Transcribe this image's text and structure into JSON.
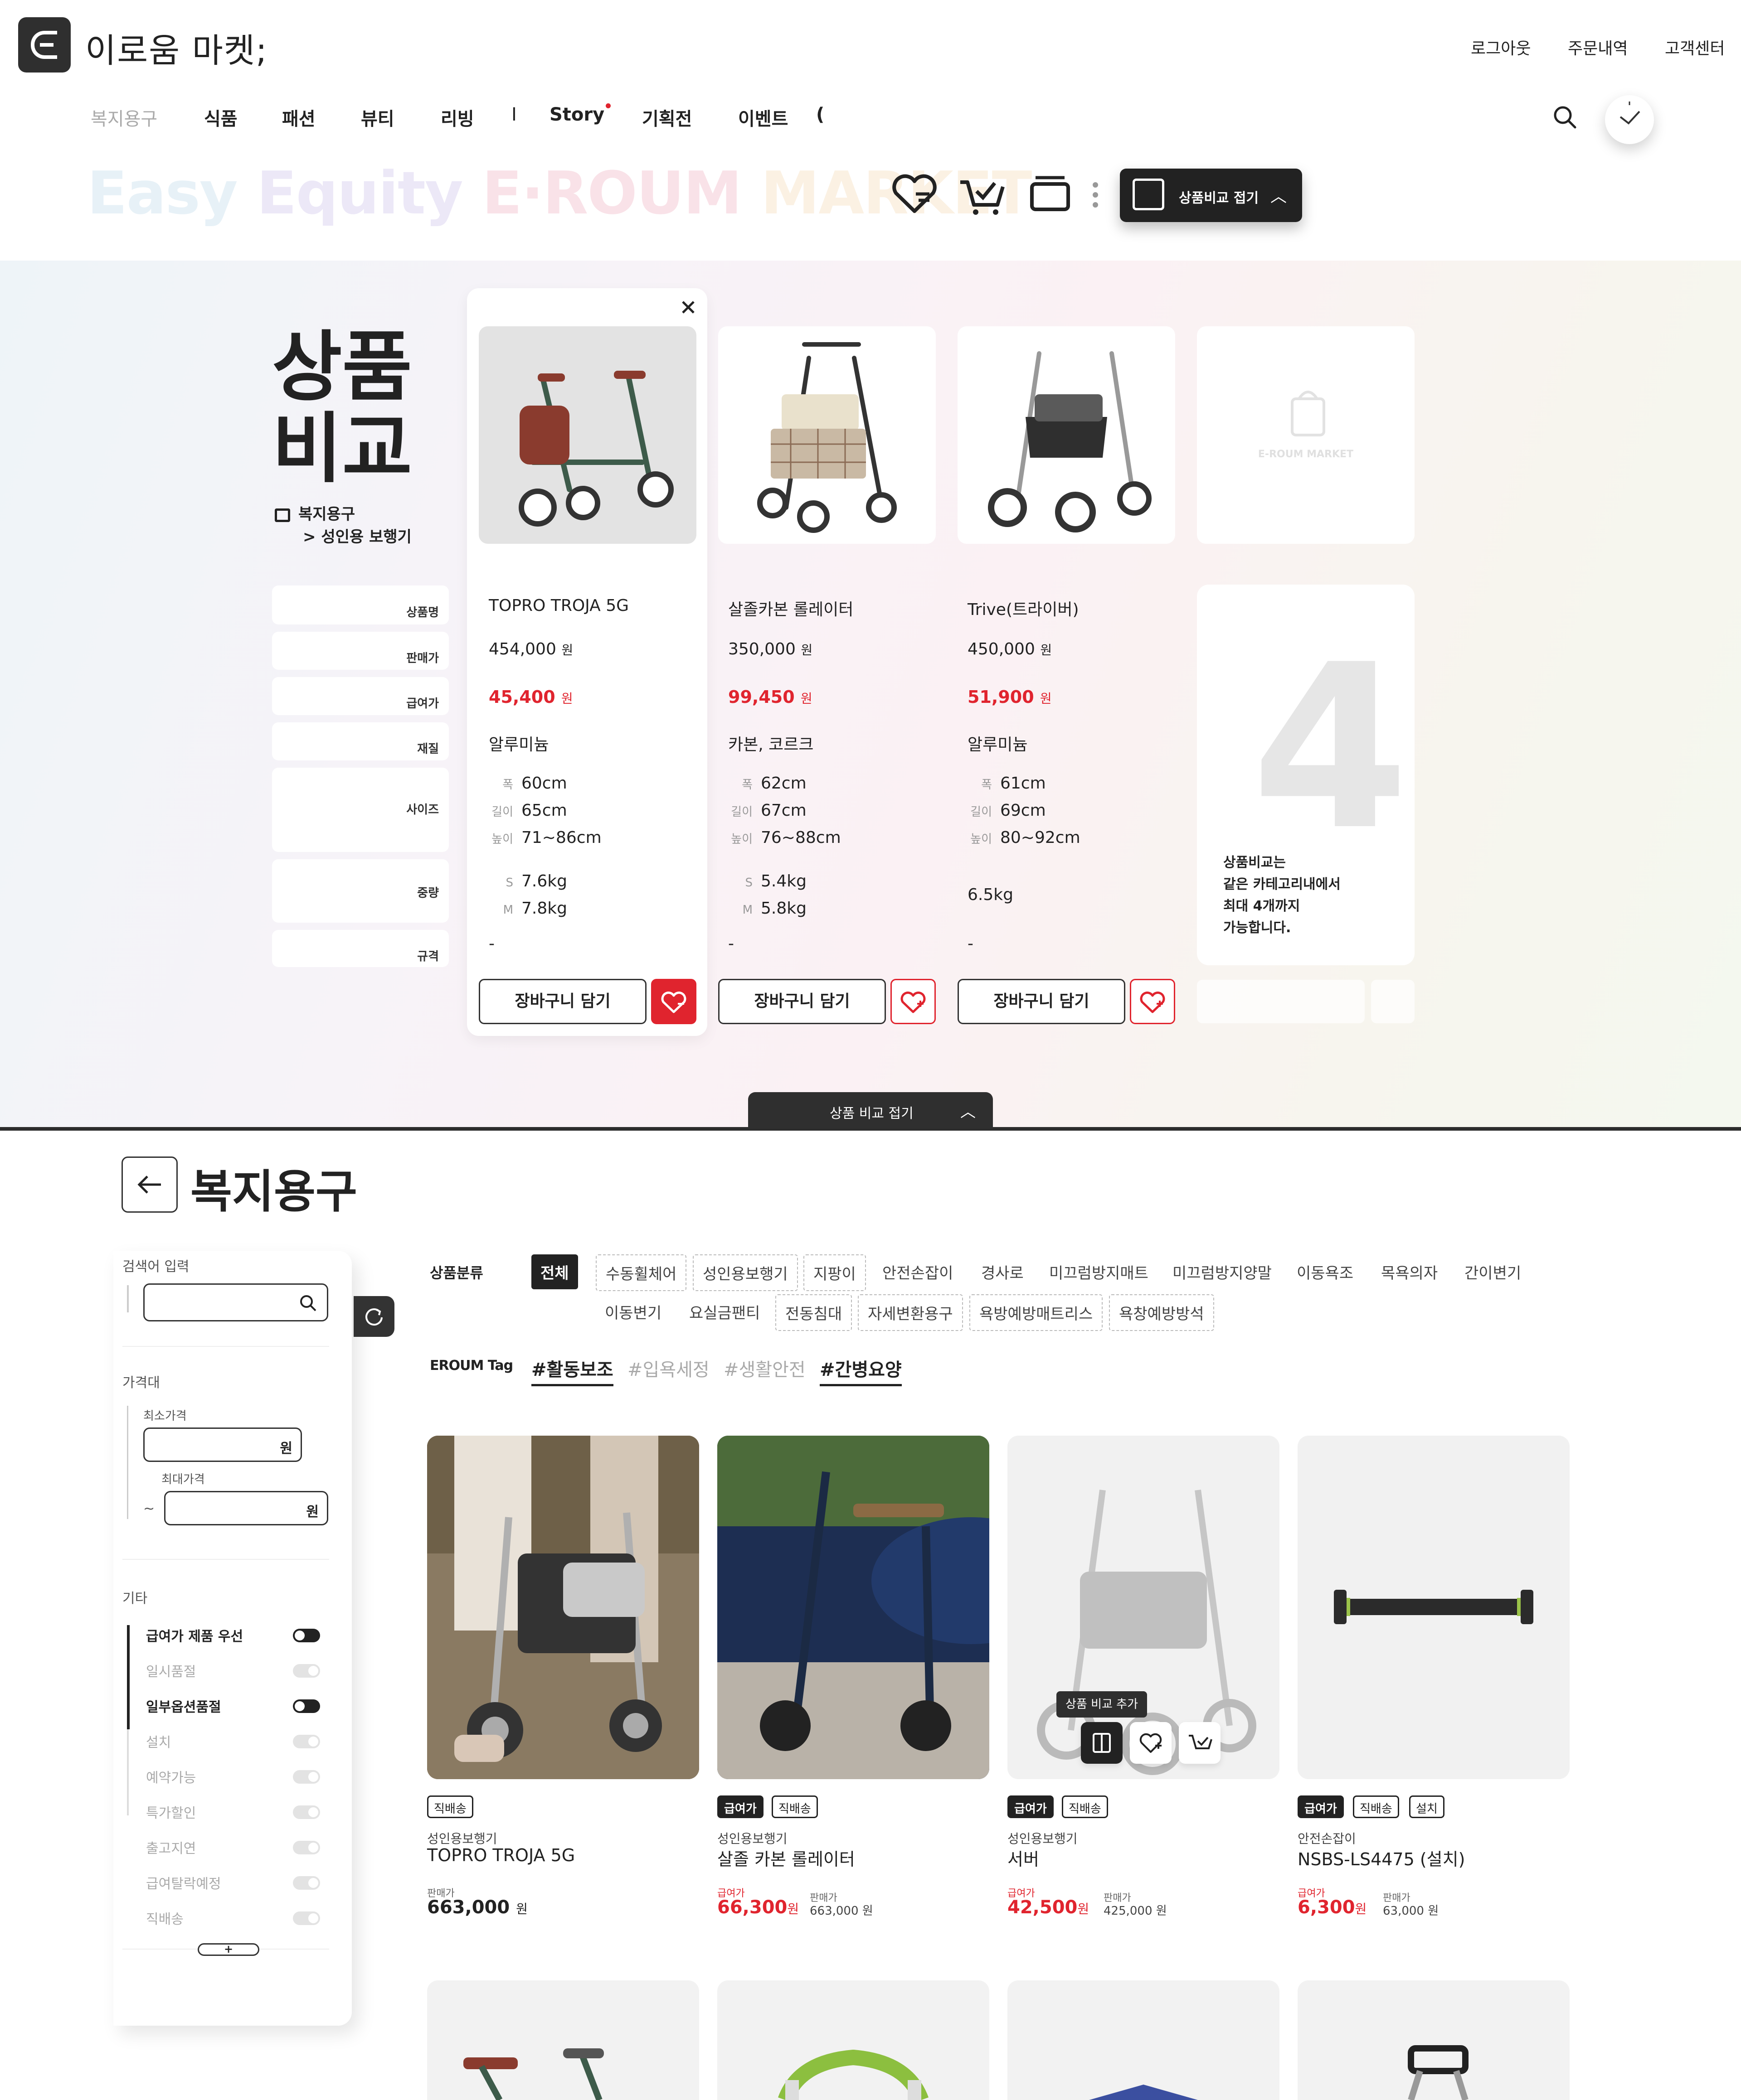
{
  "header": {
    "brand": "이로움 마켓;",
    "links": [
      "로그아웃",
      "주문내역",
      "고객센터"
    ],
    "nav": [
      "복지용구",
      "식품",
      "패션",
      "뷰티",
      "리빙",
      "I",
      "Story",
      "기획전",
      "이벤트",
      "("
    ],
    "tagline": {
      "part1": "Easy ",
      "part2": "Equity ",
      "part3": "E·ROUM ",
      "part4": "MARKET"
    },
    "compare_toggle": "상품비교 접기"
  },
  "compare": {
    "title_line1": "상품",
    "title_line2": "비교",
    "crumb_line1": "복지용구",
    "crumb_line2": "> 성인용 보행기",
    "row_labels": [
      "상품명",
      "판매가",
      "급여가",
      "재질",
      "사이즈",
      "중량",
      "규격"
    ],
    "dimension_labels": {
      "width": "폭",
      "length": "길이",
      "height": "높이"
    },
    "products": [
      {
        "name": "TOPRO TROJA 5G",
        "price": "454,000",
        "benefit": "45,400",
        "material": "알루미늄",
        "width": "60cm",
        "length": "65cm",
        "height": "71~86cm",
        "weight_s_label": "S",
        "weight_s": "7.6kg",
        "weight_m_label": "M",
        "weight_m": "7.8kg",
        "spec": "-",
        "cart": "장바구니 담기"
      },
      {
        "name": "살졸카본 롤레이터",
        "price": "350,000",
        "benefit": "99,450",
        "material": "카본, 코르크",
        "width": "62cm",
        "length": "67cm",
        "height": "76~88cm",
        "weight_s_label": "S",
        "weight_s": "5.4kg",
        "weight_m_label": "M",
        "weight_m": "5.8kg",
        "spec": "-",
        "cart": "장바구니 담기"
      },
      {
        "name": "Trive(트라이버)",
        "price": "450,000",
        "benefit": "51,900",
        "material": "알루미늄",
        "width": "61cm",
        "length": "69cm",
        "height": "80~92cm",
        "weight_single": "6.5kg",
        "spec": "-",
        "cart": "장바구니 담기"
      }
    ],
    "won": "원",
    "empty_watermark": "E-ROUM MARKET",
    "empty_number": "4",
    "empty_hint": [
      "상품비교는",
      "같은 카테고리내에서",
      "최대 4개까지",
      "가능합니다."
    ],
    "collapse_label": "상품 비교 접기"
  },
  "listing": {
    "title": "복지용구",
    "sidebar": {
      "search_label": "검색어 입력",
      "price_label": "가격대",
      "min_label": "최소가격",
      "max_label": "최대가격",
      "won": "원",
      "tilde": "~",
      "etc_label": "기타",
      "toggles": [
        {
          "label": "급여가 제품 우선",
          "on": true
        },
        {
          "label": "일시품절",
          "on": false
        },
        {
          "label": "일부옵션품절",
          "on": true
        },
        {
          "label": "설치",
          "on": false
        },
        {
          "label": "예약가능",
          "on": false
        },
        {
          "label": "특가할인",
          "on": false
        },
        {
          "label": "출고지연",
          "on": false
        },
        {
          "label": "급여탈락예정",
          "on": false
        },
        {
          "label": "직배송",
          "on": false
        }
      ],
      "more": "+"
    },
    "category_head": "상품분류",
    "categories_row1": [
      "전체",
      "수동휠체어",
      "성인용보행기",
      "지팡이",
      "안전손잡이",
      "경사로",
      "미끄럼방지매트",
      "미끄럼방지양말",
      "이동욕조",
      "목욕의자",
      "간이변기"
    ],
    "categories_row2": [
      "이동변기",
      "요실금팬티",
      "전동침대",
      "자세변환용구",
      "욕방예방매트리스",
      "욕창예방방석"
    ],
    "tag_head": "EROUM Tag",
    "tags": [
      "#활동보조",
      "#입욕세정",
      "#생활안전",
      "#간병요양"
    ],
    "compare_add_tooltip": "상품 비교 추가",
    "benefit_label": "급여가",
    "price_label": "판매가",
    "products": [
      {
        "badges": [
          "직배송"
        ],
        "dark": [],
        "category": "성인용보행기",
        "name": "TOPRO TROJA 5G",
        "price": "663,000",
        "benefit": ""
      },
      {
        "badges": [
          "급여가",
          "직배송"
        ],
        "dark": [
          0
        ],
        "category": "성인용보행기",
        "name": "살졸 카본 롤레이터",
        "price": "663,000 원",
        "benefit": "66,300"
      },
      {
        "badges": [
          "급여가",
          "직배송"
        ],
        "dark": [
          0
        ],
        "category": "성인용보행기",
        "name": "서버",
        "price": "425,000 원",
        "benefit": "42,500"
      },
      {
        "badges": [
          "급여가",
          "직배송",
          "설치"
        ],
        "dark": [
          0
        ],
        "category": "안전손잡이",
        "name": "NSBS-LS4475 (설치)",
        "price": "63,000 원",
        "benefit": "6,300"
      }
    ]
  },
  "colors": {
    "accent_red": "#e0242e",
    "dark": "#222222"
  }
}
